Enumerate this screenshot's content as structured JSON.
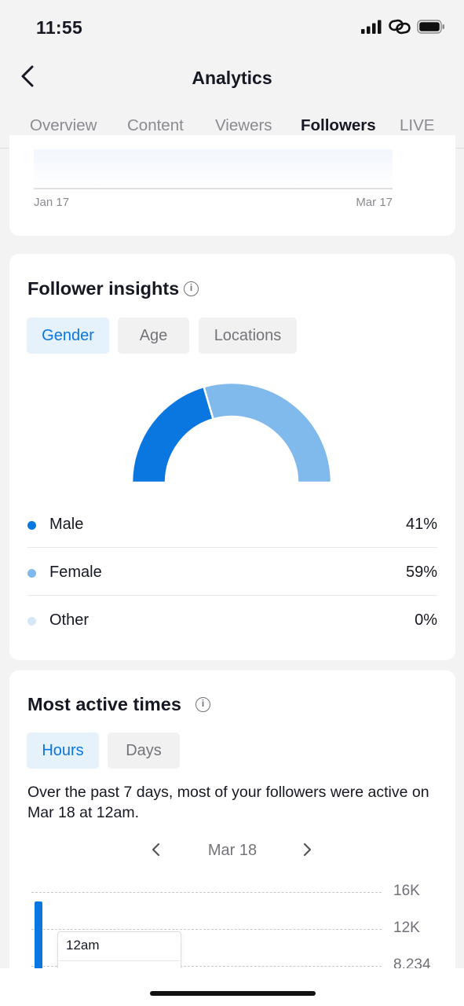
{
  "status_bar": {
    "time": "11:55",
    "icons": [
      "cellular-signal-icon",
      "link-icon",
      "battery-icon"
    ]
  },
  "header": {
    "title": "Analytics",
    "back_icon": "chevron-left-icon"
  },
  "tabs": [
    {
      "label": "Overview",
      "active": false
    },
    {
      "label": "Content",
      "active": false
    },
    {
      "label": "Viewers",
      "active": false
    },
    {
      "label": "Followers",
      "active": true
    },
    {
      "label": "LIVE",
      "active": false
    }
  ],
  "followers_chart": {
    "start_label": "Jan 17",
    "end_label": "Mar 17"
  },
  "follower_insights": {
    "title": "Follower insights",
    "filters": [
      {
        "label": "Gender",
        "active": true
      },
      {
        "label": "Age",
        "active": false
      },
      {
        "label": "Locations",
        "active": false
      }
    ],
    "legend": [
      {
        "name": "Male",
        "value": "41%",
        "color": "#0a76e0"
      },
      {
        "name": "Female",
        "value": "59%",
        "color": "#80b9ec"
      },
      {
        "name": "Other",
        "value": "0%",
        "color": "#d4e8f8"
      }
    ]
  },
  "most_active_times": {
    "title": "Most active times",
    "filters": [
      {
        "label": "Hours",
        "active": true
      },
      {
        "label": "Days",
        "active": false
      }
    ],
    "summary": "Over the past 7 days, most of your followers were active on Mar 18 at 12am.",
    "date_nav": {
      "label": "Mar 18",
      "prev_icon": "chevron-left-icon",
      "next_icon": "chevron-right-icon"
    },
    "tooltip": {
      "label": "12am"
    }
  },
  "chart_data": [
    {
      "type": "pie",
      "title": "",
      "categories": [
        "Male",
        "Female",
        "Other"
      ],
      "values": [
        41,
        59,
        0
      ],
      "colors": [
        "#0a76e0",
        "#80b9ec",
        "#d4e8f8"
      ],
      "style": "half-donut"
    },
    {
      "type": "bar",
      "title": "",
      "y_ticks": [
        "16K",
        "12K",
        "8,234"
      ],
      "ylim": [
        0,
        16000
      ],
      "x": [
        "12am"
      ],
      "values": [
        15000
      ],
      "grid": true
    }
  ],
  "colors": {
    "accent": "#0a76e0",
    "accent_light": "#80b9ec",
    "chip_active_bg": "#e5f1fb"
  }
}
